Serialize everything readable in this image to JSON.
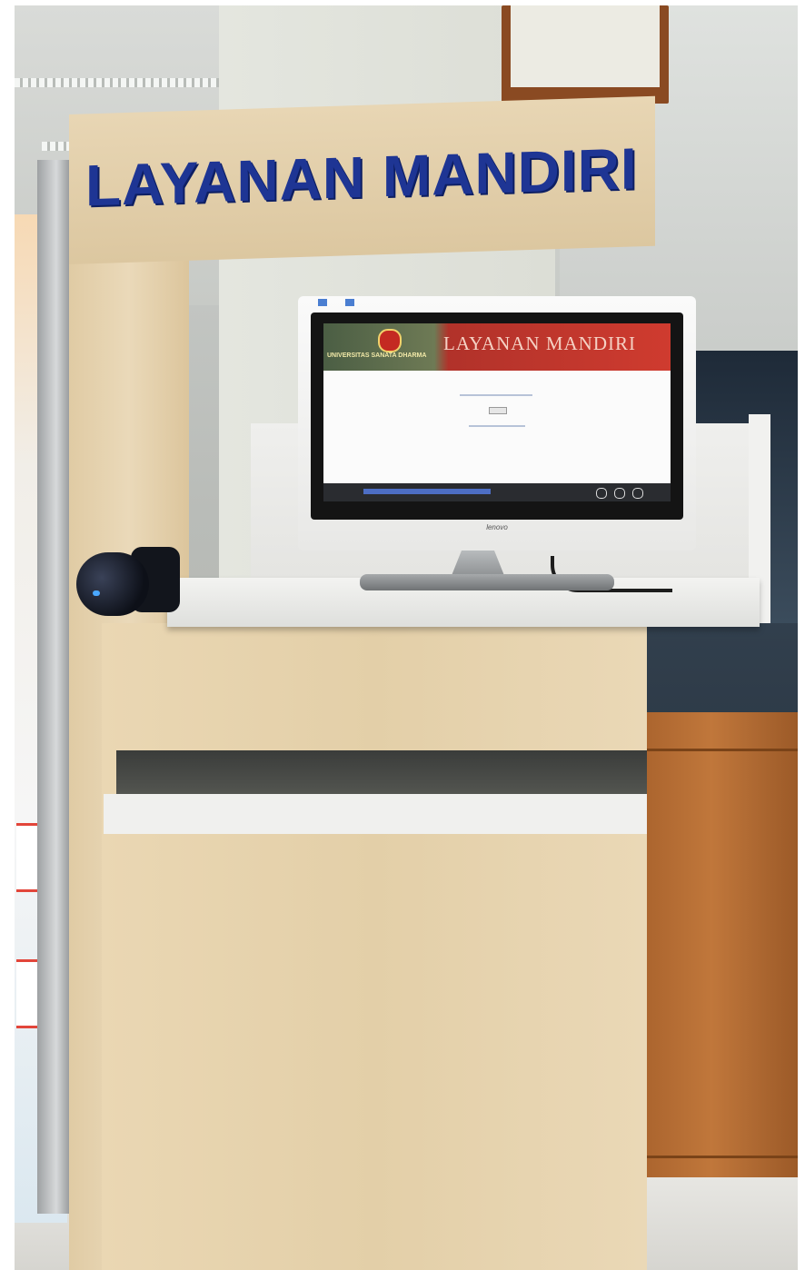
{
  "sign": {
    "text": "LAYANAN MANDIRI"
  },
  "screen": {
    "title": "LAYANAN MANDIRI",
    "university": "UNIVERSITAS SANATA DHARMA"
  },
  "monitor": {
    "brand": "lenovo"
  },
  "colors": {
    "sign_text": "#1e3594",
    "wood": "#e3cfa8",
    "screen_header": "#cf3b2f"
  }
}
